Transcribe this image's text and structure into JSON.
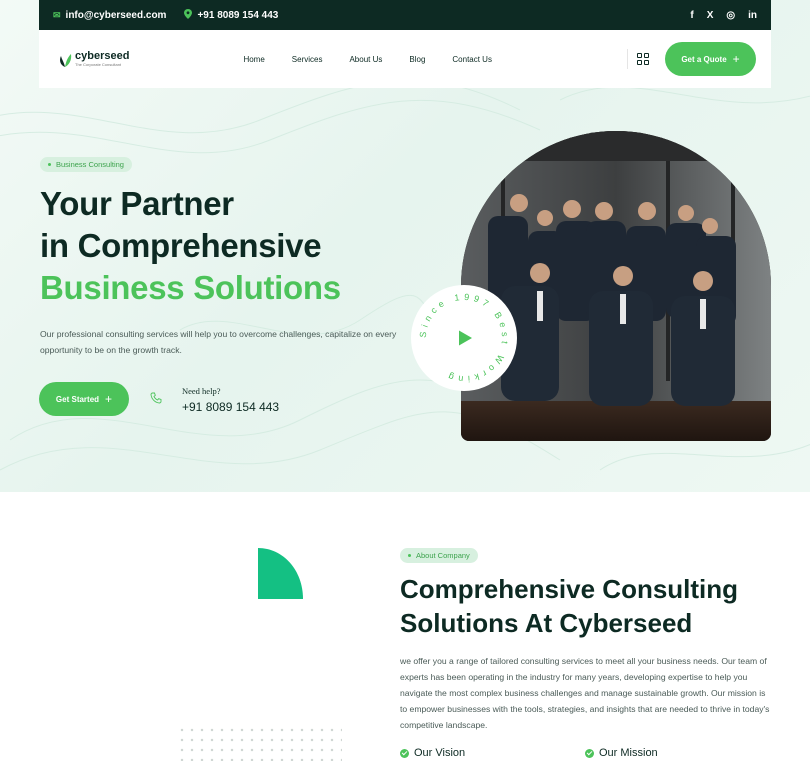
{
  "topbar": {
    "email": "info@cyberseed.com",
    "phone": "+91 8089 154 443",
    "socials": [
      "f",
      "X",
      "◎",
      "in"
    ],
    "icons": [
      "envelope-icon",
      "location-pin-icon",
      "facebook-icon",
      "x-twitter-icon",
      "instagram-icon",
      "linkedin-icon"
    ]
  },
  "nav": {
    "logo_name": "cyberseed",
    "logo_tagline": "The Corporate Consultant",
    "items": [
      "Home",
      "Services",
      "About Us",
      "Blog",
      "Contact Us"
    ],
    "quote_button": "Get a Quote",
    "plus": "+"
  },
  "hero": {
    "badge": "Business Consulting",
    "title_line1": "Your Partner",
    "title_line2": "in Comprehensive",
    "title_line3": "Business Solutions",
    "description": "Our professional consulting services will help you to overcome challenges, capitalize on every opportunity to be on the growth track.",
    "cta": "Get Started",
    "help_label": "Need help?",
    "help_phone": "+91 8089 154 443",
    "circle_text": "Since 1997 Best Working"
  },
  "about": {
    "badge": "About Company",
    "title_line1": "Comprehensive Consulting",
    "title_line2": "Solutions At Cyberseed",
    "description": "we offer you a range of tailored consulting services to meet all your business needs. Our team of experts has been operating in the industry for many years, developing expertise to help you navigate the most complex business challenges and manage sustainable growth. Our mission is to empower businesses with the tools, strategies, and insights that are needed to thrive in today's competitive landscape.",
    "feature_1": "Our Vision",
    "feature_2": "Our Mission"
  },
  "colors": {
    "accent": "#4cc35a",
    "dark": "#0d2a23",
    "teal_shape": "#14c083"
  }
}
